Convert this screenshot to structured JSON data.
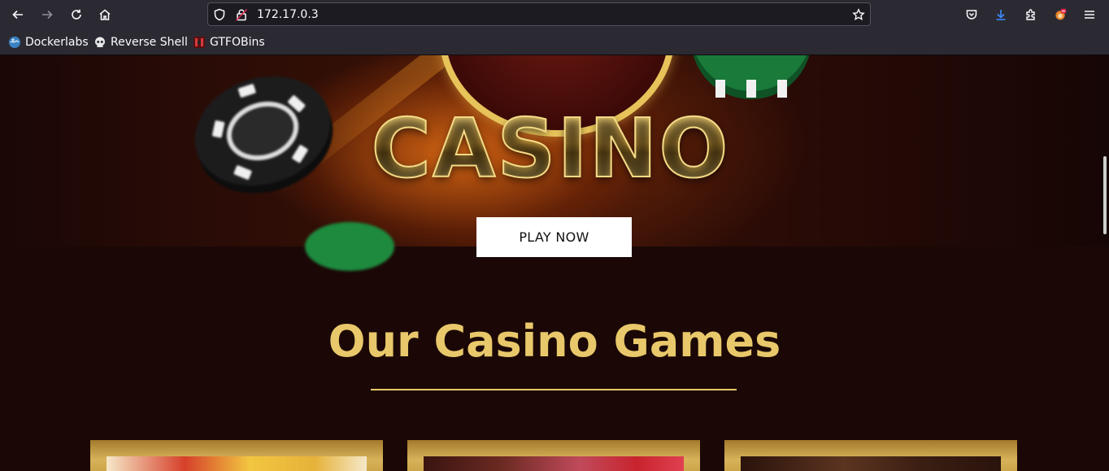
{
  "browser": {
    "url": "172.17.0.3",
    "nav": {
      "back_icon": "arrow-left-icon",
      "forward_icon": "arrow-right-icon",
      "reload_icon": "reload-icon",
      "home_icon": "home-icon"
    },
    "bookmarks": [
      {
        "label": "Dockerlabs",
        "icon": "docker-globe-icon"
      },
      {
        "label": "Reverse Shell",
        "icon": "skull-icon"
      },
      {
        "label": "GTFOBins",
        "icon": "gtfobins-icon"
      }
    ],
    "colors": {
      "toolbar": "#2b2a33",
      "urlbar": "#1c1b22",
      "download_accent": "#3d8bff"
    }
  },
  "hero": {
    "logo_text": "CASINO",
    "play_button": "PLAY NOW"
  },
  "games": {
    "title": "Our Casino Games",
    "accent_color": "#e8c86a"
  }
}
